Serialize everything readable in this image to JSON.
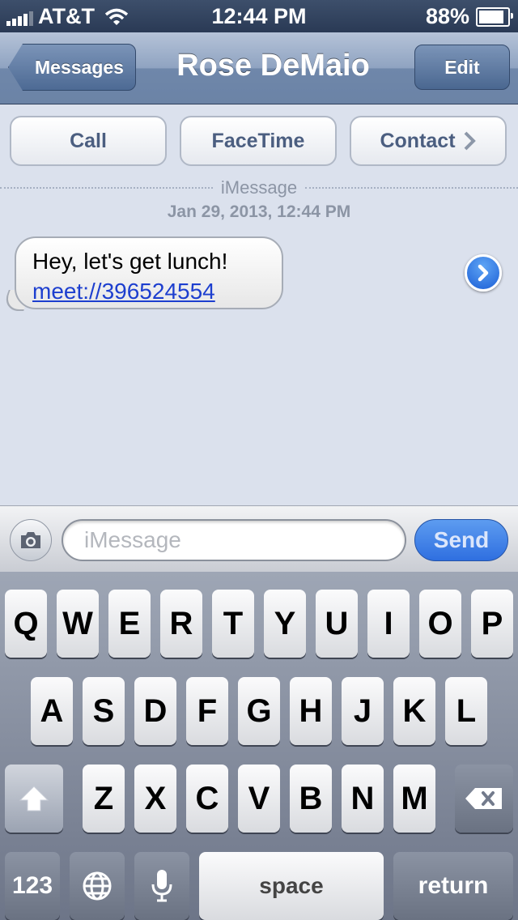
{
  "status_bar": {
    "carrier": "AT&T",
    "time": "12:44 PM",
    "battery": "88%",
    "battery_level": 0.88
  },
  "nav": {
    "back_label": "Messages",
    "title": "Rose DeMaio",
    "edit_label": "Edit"
  },
  "actions": {
    "call": "Call",
    "facetime": "FaceTime",
    "contact": "Contact"
  },
  "conversation": {
    "service": "iMessage",
    "timestamp": "Jan 29, 2013, 12:44 PM",
    "message_text": "Hey, let's get lunch!",
    "message_link": "meet://396524554"
  },
  "compose": {
    "placeholder": "iMessage",
    "send_label": "Send"
  },
  "keyboard": {
    "row1": [
      "Q",
      "W",
      "E",
      "R",
      "T",
      "Y",
      "U",
      "I",
      "O",
      "P"
    ],
    "row2": [
      "A",
      "S",
      "D",
      "F",
      "G",
      "H",
      "J",
      "K",
      "L"
    ],
    "row3": [
      "Z",
      "X",
      "C",
      "V",
      "B",
      "N",
      "M"
    ],
    "numbers_label": "123",
    "space_label": "space",
    "return_label": "return"
  },
  "colors": {
    "nav_bar": "#7089ac",
    "link": "#1d3fcf",
    "send_button": "#2f6fe0",
    "background": "#dbe1ed"
  },
  "icons": [
    "wifi-icon",
    "camera-icon",
    "globe-icon",
    "microphone-icon",
    "shift-icon",
    "delete-icon",
    "chevron-right-icon"
  ]
}
